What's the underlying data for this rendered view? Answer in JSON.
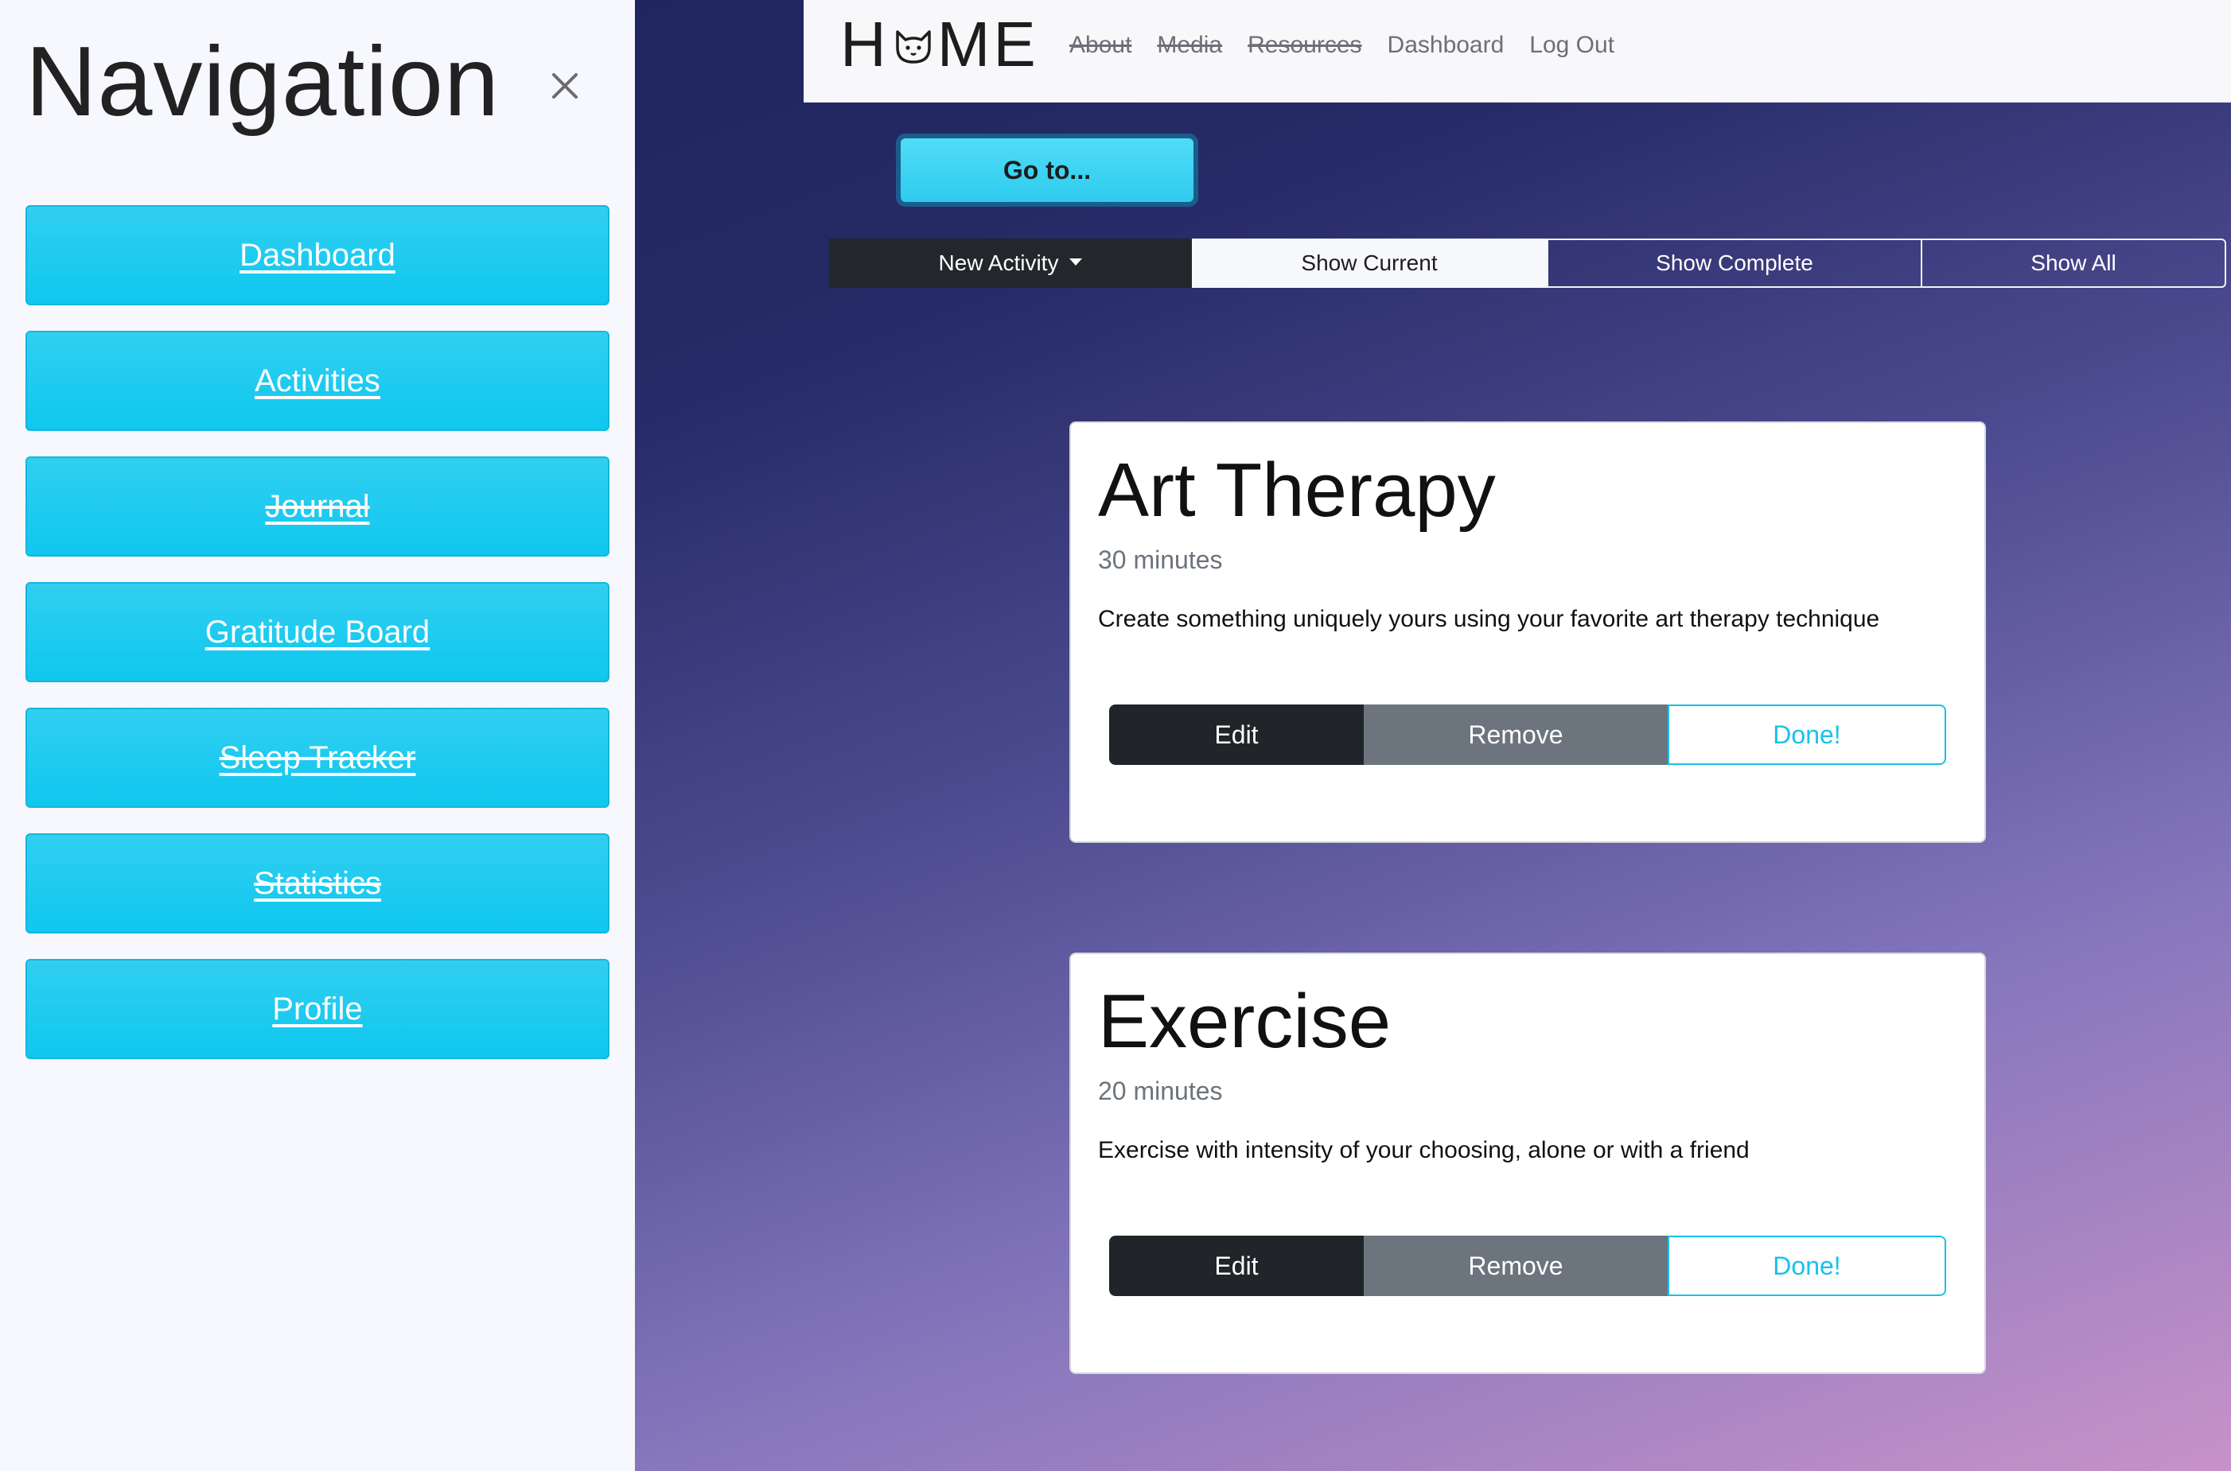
{
  "sidebar": {
    "title": "Navigation",
    "close_icon": "close-icon",
    "items": [
      {
        "label": "Dashboard",
        "strikethrough": false
      },
      {
        "label": "Activities",
        "strikethrough": false
      },
      {
        "label": "Journal",
        "strikethrough": true
      },
      {
        "label": "Gratitude Board",
        "strikethrough": false
      },
      {
        "label": "Sleep Tracker",
        "strikethrough": true
      },
      {
        "label": "Statistics",
        "strikethrough": true
      },
      {
        "label": "Profile",
        "strikethrough": false
      }
    ]
  },
  "topbar": {
    "brand_left": "H",
    "brand_icon": "cat-icon",
    "brand_right": "ME",
    "links": [
      {
        "label": "About",
        "strikethrough": true
      },
      {
        "label": "Media",
        "strikethrough": true
      },
      {
        "label": "Resources",
        "strikethrough": true
      },
      {
        "label": "Dashboard",
        "strikethrough": false
      },
      {
        "label": "Log Out",
        "strikethrough": false
      }
    ]
  },
  "goto_button": {
    "label": "Go to..."
  },
  "filters": {
    "new_activity": "New Activity",
    "show_current": "Show Current",
    "show_complete": "Show Complete",
    "show_all": "Show All"
  },
  "activities": [
    {
      "title": "Art Therapy",
      "duration": "30 minutes",
      "description": "Create something uniquely yours using your favorite art therapy technique",
      "edit_label": "Edit",
      "remove_label": "Remove",
      "done_label": "Done!"
    },
    {
      "title": "Exercise",
      "duration": "20 minutes",
      "description": "Exercise with intensity of your choosing, alone or with a friend",
      "edit_label": "Edit",
      "remove_label": "Remove",
      "done_label": "Done!"
    }
  ],
  "colors": {
    "accent": "#0fc7ef",
    "dark_button": "#212529",
    "secondary_button": "#6c757d",
    "sidebar_bg": "#f7f8fd"
  }
}
